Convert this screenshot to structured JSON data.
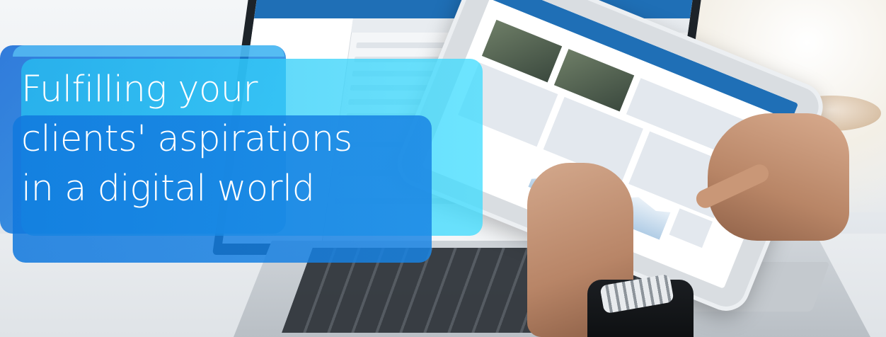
{
  "hero": {
    "headline_lines": [
      "Fulfilling your",
      "clients' aspirations",
      "in a digital world"
    ],
    "colors": {
      "box_primary": "#166bd7",
      "box_cyan": "#26bef0",
      "box_deep": "#1078de",
      "headline_text": "#ffffff",
      "app_topbar": "#1f6fb6"
    }
  }
}
